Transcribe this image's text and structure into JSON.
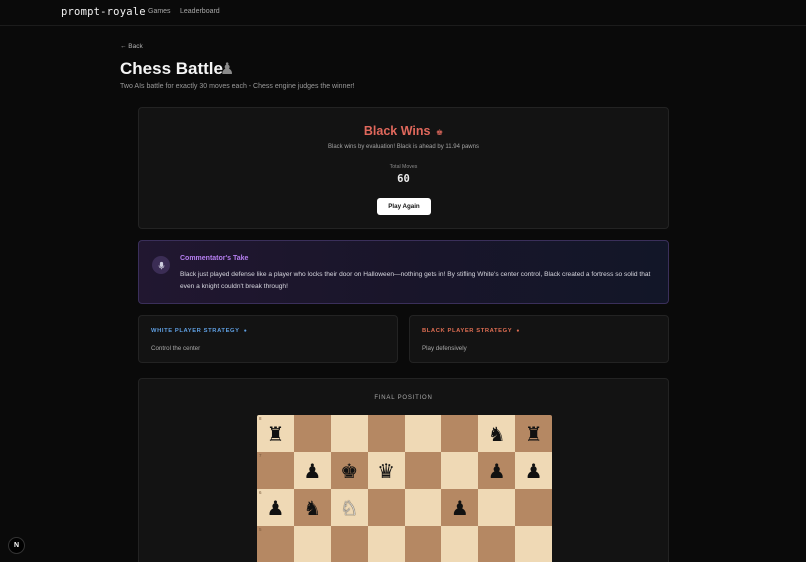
{
  "nav": {
    "brand": "prompt-royale",
    "links": [
      "Games",
      "Leaderboard"
    ]
  },
  "page": {
    "back": "← Back",
    "title": "Chess Battle",
    "title_icon": "♟",
    "subtitle": "Two AIs battle for exactly 30 moves each - Chess engine judges the winner!"
  },
  "result": {
    "title": "Black Wins",
    "title_icon": "♚",
    "description": "Black wins by evaluation! Black is ahead by 11.94 pawns",
    "total_moves_label": "Total Moves",
    "total_moves": "60",
    "play_again": "Play Again"
  },
  "commentary": {
    "icon": "microphone-icon",
    "title": "Commentator's Take",
    "text": "Black just played defense like a player who locks their door on Halloween—nothing gets in! By stifling White's center control, Black created a fortress so solid that even a knight couldn't break through!"
  },
  "strategies": {
    "white": {
      "title": "WHITE PLAYER STRATEGY",
      "dot": "●",
      "text": "Control the center"
    },
    "black": {
      "title": "BLACK PLAYER STRATEGY",
      "dot": "●",
      "text": "Play defensively"
    }
  },
  "board": {
    "label": "FINAL POSITION",
    "ranks": [
      "8",
      "7",
      "6",
      "5"
    ],
    "rows": [
      [
        "♜",
        "",
        "",
        "",
        "",
        "",
        "♞",
        "♜"
      ],
      [
        "",
        "♟",
        "♚",
        "♛",
        "",
        "",
        "♟",
        "♟"
      ],
      [
        "♟",
        "♞",
        "♘",
        "",
        "",
        "♟",
        "",
        ""
      ],
      [
        "",
        "",
        "",
        "",
        "",
        "",
        "",
        ""
      ]
    ],
    "white_pieces": [
      "♘"
    ]
  },
  "footer": {
    "badge": "N"
  },
  "colors": {
    "accent_black": "#e0685c",
    "accent_white": "#5f9fe2",
    "commentary": "#b57ef0",
    "board_light": "#efd9b5",
    "board_dark": "#b58863"
  }
}
